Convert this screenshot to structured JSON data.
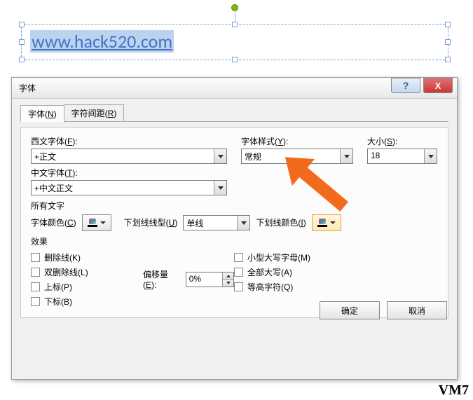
{
  "textbox": {
    "link": "www.hack520.com"
  },
  "dialog": {
    "title": "字体",
    "tabs": [
      {
        "label": "字体(",
        "accel": "N",
        "tail": ")"
      },
      {
        "label": "字符间距(",
        "accel": "R",
        "tail": ")"
      }
    ],
    "latin_font_label": "西文字体(",
    "latin_font_accel": "F",
    "latin_font_tail": "):",
    "latin_font_value": "+正文",
    "style_label": "字体样式(",
    "style_accel": "Y",
    "style_tail": "):",
    "style_value": "常规",
    "size_label": "大小(",
    "size_accel": "S",
    "size_tail": "):",
    "size_value": "18",
    "asian_font_label": "中文字体(",
    "asian_font_accel": "T",
    "asian_font_tail": "):",
    "asian_font_value": "+中文正文",
    "all_text_label": "所有文字",
    "font_color_label": "字体颜色(",
    "font_color_accel": "C",
    "font_color_tail": ")",
    "underline_style_label": "下划线线型(",
    "underline_style_accel": "U",
    "underline_style_tail": ")",
    "underline_style_value": "单线",
    "underline_color_label": "下划线颜色(",
    "underline_color_accel": "I",
    "underline_color_tail": ")",
    "effects_label": "效果",
    "strike_label": "删除线(",
    "strike_accel": "K",
    "strike_tail": ")",
    "dstrike_label": "双删除线(",
    "dstrike_accel": "L",
    "dstrike_tail": ")",
    "super_label": "上标(",
    "super_accel": "P",
    "super_tail": ")",
    "sub_label": "下标(",
    "sub_accel": "B",
    "sub_tail": ")",
    "offset_label": "偏移量(",
    "offset_accel": "E",
    "offset_tail": "):",
    "offset_value": "0%",
    "smallcaps_label": "小型大写字母(",
    "smallcaps_accel": "M",
    "smallcaps_tail": ")",
    "allcaps_label": "全部大写(",
    "allcaps_accel": "A",
    "allcaps_tail": ")",
    "equal_label": "等高字符(",
    "equal_accel": "Q",
    "equal_tail": ")",
    "ok": "确定",
    "cancel": "取消"
  },
  "watermark": "VM7"
}
